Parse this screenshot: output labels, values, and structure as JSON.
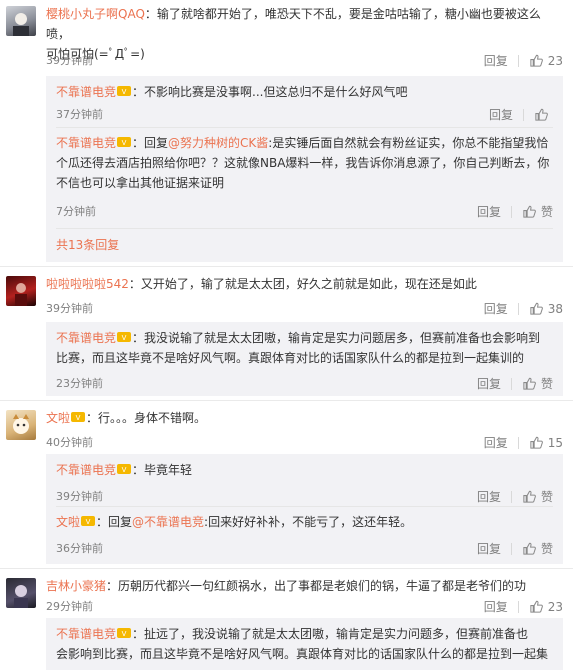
{
  "c1": {
    "user": "樱桃小丸子啊QAQ",
    "text_line1": "：输了就啥都开始了，唯恐天下不乱，要是金咕咕输了，糖小幽也要被这么喷，",
    "text_line2": "可怕可怕(=ﾟДﾟ=)",
    "time": "39分钟前",
    "reply": "回复",
    "likes": "23",
    "replies": [
      {
        "user": "不靠谱电竞",
        "text": "：不影响比赛是没事啊...但这总归不是什么好风气吧",
        "time": "37分钟前",
        "reply": "回复",
        "likes": ""
      },
      {
        "user": "不靠谱电竞",
        "prefix": "：回复",
        "mention": "@努力种树的CK酱",
        "text_line1": ":是实锤后面自然就会有粉丝证实，你总不能指望我恰",
        "text_line2": "个瓜还得去酒店拍照给你吧？？这就像NBA爆料一样，我告诉你消息源了，你自己判断去，你",
        "text_line3": "不信也可以拿出其他证据来证明",
        "time": "7分钟前",
        "reply": "回复",
        "likes": "赞"
      }
    ],
    "total": "共13条回复"
  },
  "c2": {
    "user": "啦啦啦啦啦542",
    "text": "：又开始了，输了就是太太团，好久之前就是如此，现在还是如此",
    "time": "39分钟前",
    "reply": "回复",
    "likes": "38",
    "replies": [
      {
        "user": "不靠谱电竞",
        "text_line1": "：我没说输了就是太太团嗷，输肯定是实力问题居多，但赛前准备也会影响到",
        "text_line2": "比赛，而且这毕竟不是啥好风气啊。真跟体育对比的话国家队什么的都是拉到一起集训的",
        "time": "23分钟前",
        "reply": "回复",
        "likes": "赞"
      }
    ]
  },
  "c3": {
    "user": "文啦",
    "text": "：行。。。身体不错啊。",
    "time": "40分钟前",
    "reply": "回复",
    "likes": "15",
    "replies": [
      {
        "user": "不靠谱电竞",
        "text": "：毕竟年轻",
        "time": "39分钟前",
        "reply": "回复",
        "likes": "赞"
      },
      {
        "user": "文啦",
        "prefix": "：回复",
        "mention": "@不靠谱电竞",
        "text": ":回来好好补补，不能亏了，这还年轻。",
        "time": "36分钟前",
        "reply": "回复",
        "likes": "赞"
      }
    ]
  },
  "c4": {
    "user": "吉林小豪猪",
    "text": "：历朝历代都兴一句红颜祸水，出了事都是老娘们的锅，牛逼了都是老爷们的功",
    "time": "29分钟前",
    "reply": "回复",
    "likes": "23",
    "replies": [
      {
        "user": "不靠谱电竞",
        "text_line1": "：扯远了，我没说输了就是太太团嗷，输肯定是实力问题多，但赛前准备也",
        "text_line2": "会影响到比赛，而且这毕竟不是啥好风气啊。真跟体育对比的话国家队什么的都是拉到一起集"
      }
    ]
  },
  "colors": {
    "link": "#eb7350",
    "muted": "#808080",
    "subbg": "#f2f2f5"
  }
}
